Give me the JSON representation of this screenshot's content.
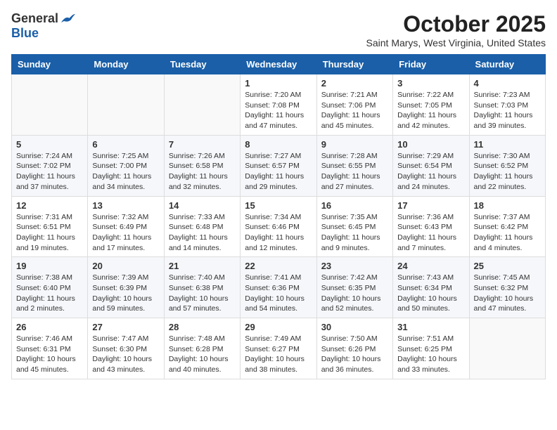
{
  "header": {
    "logo_general": "General",
    "logo_blue": "Blue",
    "month_title": "October 2025",
    "subtitle": "Saint Marys, West Virginia, United States"
  },
  "weekdays": [
    "Sunday",
    "Monday",
    "Tuesday",
    "Wednesday",
    "Thursday",
    "Friday",
    "Saturday"
  ],
  "weeks": [
    [
      {
        "day": "",
        "info": ""
      },
      {
        "day": "",
        "info": ""
      },
      {
        "day": "",
        "info": ""
      },
      {
        "day": "1",
        "info": "Sunrise: 7:20 AM\nSunset: 7:08 PM\nDaylight: 11 hours\nand 47 minutes."
      },
      {
        "day": "2",
        "info": "Sunrise: 7:21 AM\nSunset: 7:06 PM\nDaylight: 11 hours\nand 45 minutes."
      },
      {
        "day": "3",
        "info": "Sunrise: 7:22 AM\nSunset: 7:05 PM\nDaylight: 11 hours\nand 42 minutes."
      },
      {
        "day": "4",
        "info": "Sunrise: 7:23 AM\nSunset: 7:03 PM\nDaylight: 11 hours\nand 39 minutes."
      }
    ],
    [
      {
        "day": "5",
        "info": "Sunrise: 7:24 AM\nSunset: 7:02 PM\nDaylight: 11 hours\nand 37 minutes."
      },
      {
        "day": "6",
        "info": "Sunrise: 7:25 AM\nSunset: 7:00 PM\nDaylight: 11 hours\nand 34 minutes."
      },
      {
        "day": "7",
        "info": "Sunrise: 7:26 AM\nSunset: 6:58 PM\nDaylight: 11 hours\nand 32 minutes."
      },
      {
        "day": "8",
        "info": "Sunrise: 7:27 AM\nSunset: 6:57 PM\nDaylight: 11 hours\nand 29 minutes."
      },
      {
        "day": "9",
        "info": "Sunrise: 7:28 AM\nSunset: 6:55 PM\nDaylight: 11 hours\nand 27 minutes."
      },
      {
        "day": "10",
        "info": "Sunrise: 7:29 AM\nSunset: 6:54 PM\nDaylight: 11 hours\nand 24 minutes."
      },
      {
        "day": "11",
        "info": "Sunrise: 7:30 AM\nSunset: 6:52 PM\nDaylight: 11 hours\nand 22 minutes."
      }
    ],
    [
      {
        "day": "12",
        "info": "Sunrise: 7:31 AM\nSunset: 6:51 PM\nDaylight: 11 hours\nand 19 minutes."
      },
      {
        "day": "13",
        "info": "Sunrise: 7:32 AM\nSunset: 6:49 PM\nDaylight: 11 hours\nand 17 minutes."
      },
      {
        "day": "14",
        "info": "Sunrise: 7:33 AM\nSunset: 6:48 PM\nDaylight: 11 hours\nand 14 minutes."
      },
      {
        "day": "15",
        "info": "Sunrise: 7:34 AM\nSunset: 6:46 PM\nDaylight: 11 hours\nand 12 minutes."
      },
      {
        "day": "16",
        "info": "Sunrise: 7:35 AM\nSunset: 6:45 PM\nDaylight: 11 hours\nand 9 minutes."
      },
      {
        "day": "17",
        "info": "Sunrise: 7:36 AM\nSunset: 6:43 PM\nDaylight: 11 hours\nand 7 minutes."
      },
      {
        "day": "18",
        "info": "Sunrise: 7:37 AM\nSunset: 6:42 PM\nDaylight: 11 hours\nand 4 minutes."
      }
    ],
    [
      {
        "day": "19",
        "info": "Sunrise: 7:38 AM\nSunset: 6:40 PM\nDaylight: 11 hours\nand 2 minutes."
      },
      {
        "day": "20",
        "info": "Sunrise: 7:39 AM\nSunset: 6:39 PM\nDaylight: 10 hours\nand 59 minutes."
      },
      {
        "day": "21",
        "info": "Sunrise: 7:40 AM\nSunset: 6:38 PM\nDaylight: 10 hours\nand 57 minutes."
      },
      {
        "day": "22",
        "info": "Sunrise: 7:41 AM\nSunset: 6:36 PM\nDaylight: 10 hours\nand 54 minutes."
      },
      {
        "day": "23",
        "info": "Sunrise: 7:42 AM\nSunset: 6:35 PM\nDaylight: 10 hours\nand 52 minutes."
      },
      {
        "day": "24",
        "info": "Sunrise: 7:43 AM\nSunset: 6:34 PM\nDaylight: 10 hours\nand 50 minutes."
      },
      {
        "day": "25",
        "info": "Sunrise: 7:45 AM\nSunset: 6:32 PM\nDaylight: 10 hours\nand 47 minutes."
      }
    ],
    [
      {
        "day": "26",
        "info": "Sunrise: 7:46 AM\nSunset: 6:31 PM\nDaylight: 10 hours\nand 45 minutes."
      },
      {
        "day": "27",
        "info": "Sunrise: 7:47 AM\nSunset: 6:30 PM\nDaylight: 10 hours\nand 43 minutes."
      },
      {
        "day": "28",
        "info": "Sunrise: 7:48 AM\nSunset: 6:28 PM\nDaylight: 10 hours\nand 40 minutes."
      },
      {
        "day": "29",
        "info": "Sunrise: 7:49 AM\nSunset: 6:27 PM\nDaylight: 10 hours\nand 38 minutes."
      },
      {
        "day": "30",
        "info": "Sunrise: 7:50 AM\nSunset: 6:26 PM\nDaylight: 10 hours\nand 36 minutes."
      },
      {
        "day": "31",
        "info": "Sunrise: 7:51 AM\nSunset: 6:25 PM\nDaylight: 10 hours\nand 33 minutes."
      },
      {
        "day": "",
        "info": ""
      }
    ]
  ]
}
